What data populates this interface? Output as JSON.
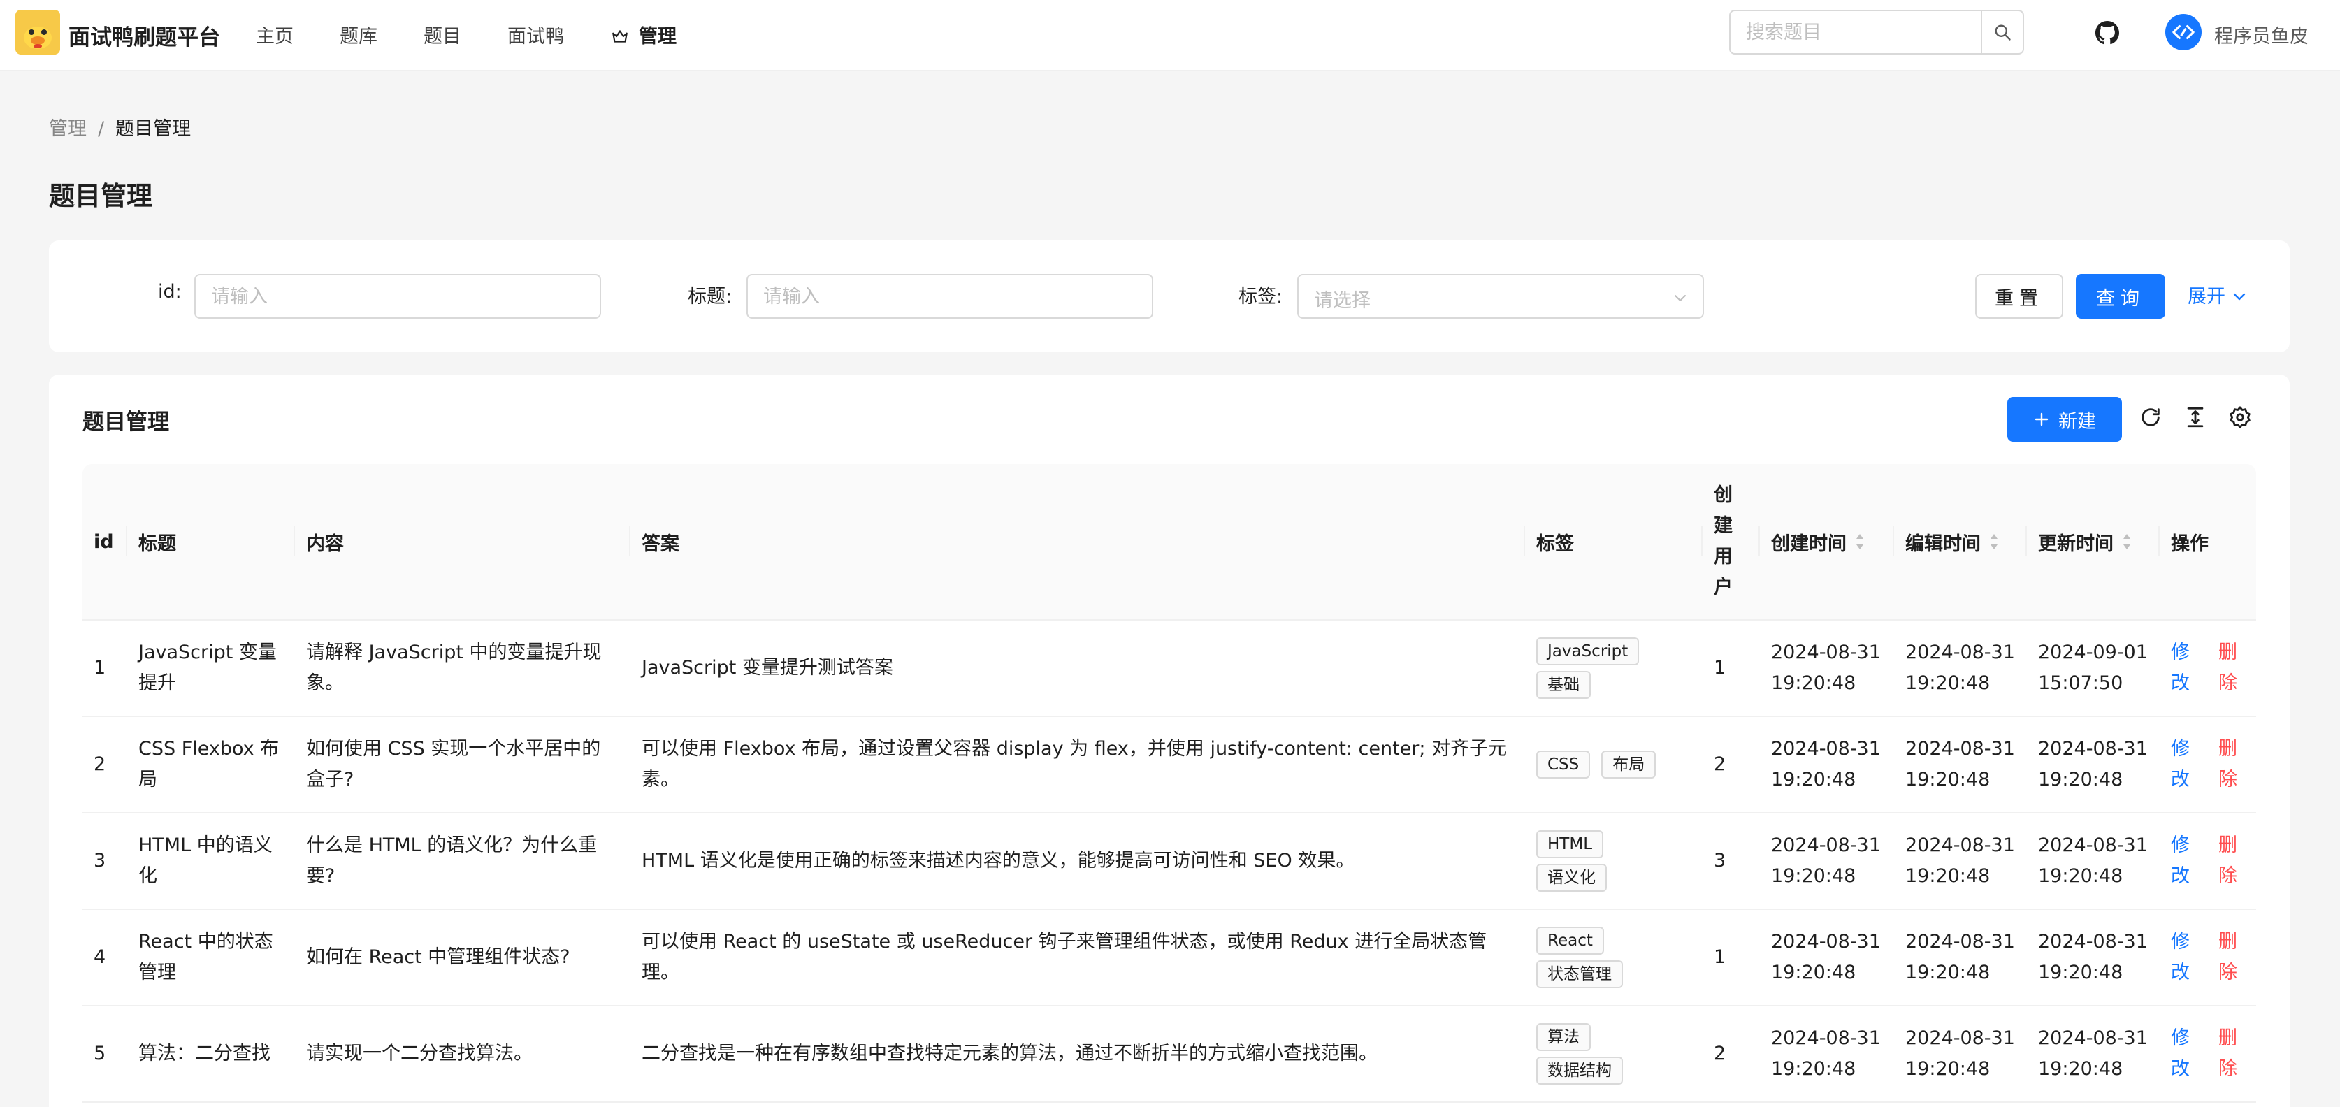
{
  "header": {
    "site_title": "面试鸭刷题平台",
    "nav": [
      "主页",
      "题库",
      "题目",
      "面试鸭",
      "管理"
    ],
    "active_nav": "管理",
    "search_placeholder": "搜索题目",
    "user_name": "程序员鱼皮"
  },
  "breadcrumb": {
    "parent": "管理",
    "separator": "/",
    "current": "题目管理"
  },
  "page_title": "题目管理",
  "filters": {
    "id_label": "id",
    "id_placeholder": "请输入",
    "title_label": "标题",
    "title_placeholder": "请输入",
    "tags_label": "标签",
    "tags_placeholder": "请选择",
    "label_colon": ":",
    "reset_label": "重置",
    "query_label": "查询",
    "expand_label": "展开"
  },
  "table": {
    "title": "题目管理",
    "new_label": "新建",
    "columns": {
      "id": "id",
      "title": "标题",
      "content": "内容",
      "answer": "答案",
      "tags": "标签",
      "creator": "创建用户",
      "created": "创建时间",
      "edited": "编辑时间",
      "updated": "更新时间",
      "actions": "操作"
    },
    "edit_label": "修改",
    "delete_label": "删除",
    "rows": [
      {
        "id": "1",
        "title": "JavaScript 变量提升",
        "content": "请解释 JavaScript 中的变量提升现象。",
        "answer": "JavaScript 变量提升测试答案",
        "tags": [
          "JavaScript",
          "基础"
        ],
        "creator": "1",
        "created": [
          "2024-08-31",
          "19:20:48"
        ],
        "edited": [
          "2024-08-31",
          "19:20:48"
        ],
        "updated": [
          "2024-09-01",
          "15:07:50"
        ]
      },
      {
        "id": "2",
        "title": "CSS Flexbox 布局",
        "content": "如何使用 CSS 实现一个水平居中的盒子?",
        "answer": "可以使用 Flexbox 布局，通过设置父容器 display 为 flex，并使用 justify-content: center; 对齐子元素。",
        "tags": [
          "CSS",
          "布局"
        ],
        "creator": "2",
        "created": [
          "2024-08-31",
          "19:20:48"
        ],
        "edited": [
          "2024-08-31",
          "19:20:48"
        ],
        "updated": [
          "2024-08-31",
          "19:20:48"
        ]
      },
      {
        "id": "3",
        "title": "HTML 中的语义化",
        "content": "什么是 HTML 的语义化？为什么重要?",
        "answer": "HTML 语义化是使用正确的标签来描述内容的意义，能够提高可访问性和 SEO 效果。",
        "tags": [
          "HTML",
          "语义化"
        ],
        "creator": "3",
        "created": [
          "2024-08-31",
          "19:20:48"
        ],
        "edited": [
          "2024-08-31",
          "19:20:48"
        ],
        "updated": [
          "2024-08-31",
          "19:20:48"
        ]
      },
      {
        "id": "4",
        "title": "React 中的状态管理",
        "content": "如何在 React 中管理组件状态?",
        "answer": "可以使用 React 的 useState 或 useReducer 钩子来管理组件状态，或使用 Redux 进行全局状态管理。",
        "tags": [
          "React",
          "状态管理"
        ],
        "creator": "1",
        "created": [
          "2024-08-31",
          "19:20:48"
        ],
        "edited": [
          "2024-08-31",
          "19:20:48"
        ],
        "updated": [
          "2024-08-31",
          "19:20:48"
        ]
      },
      {
        "id": "5",
        "title": "算法：二分查找",
        "content": "请实现一个二分查找算法。",
        "answer": "二分查找是一种在有序数组中查找特定元素的算法，通过不断折半的方式缩小查找范围。",
        "tags": [
          "算法",
          "数据结构"
        ],
        "creator": "2",
        "created": [
          "2024-08-31",
          "19:20:48"
        ],
        "edited": [
          "2024-08-31",
          "19:20:48"
        ],
        "updated": [
          "2024-08-31",
          "19:20:48"
        ]
      }
    ]
  },
  "colors": {
    "primary": "#1677ff",
    "danger": "#ff4d4f",
    "logo_bg": "#f7c948"
  },
  "icons": [
    "duck-logo-icon",
    "crown-icon",
    "search-icon",
    "github-icon",
    "code-avatar-icon",
    "chevron-down-icon",
    "plus-icon",
    "reload-icon",
    "column-height-icon",
    "setting-icon",
    "sort-icon"
  ]
}
